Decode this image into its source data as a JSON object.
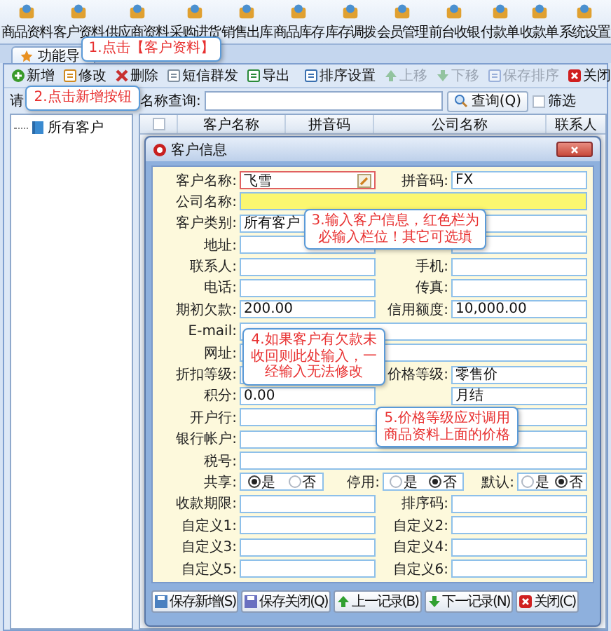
{
  "main_toolbar": [
    "商品资料",
    "客户资料",
    "供应商资料",
    "采购进货",
    "销售出库",
    "商品库存",
    "库存调拨",
    "会员管理",
    "前台收银",
    "付款单",
    "收款单",
    "系统设置"
  ],
  "tab": {
    "label": "功能导"
  },
  "toolbar": [
    {
      "label": "新增",
      "kind": "add",
      "disabled": false
    },
    {
      "label": "修改",
      "kind": "edit",
      "disabled": false
    },
    {
      "label": "删除",
      "kind": "delete",
      "disabled": false
    },
    {
      "label": "短信群发",
      "kind": "sms",
      "disabled": false
    },
    {
      "label": "导出",
      "kind": "export",
      "disabled": false
    },
    {
      "label": "排序设置",
      "kind": "sort",
      "disabled": false
    },
    {
      "label": "上移",
      "kind": "up",
      "disabled": true
    },
    {
      "label": "下移",
      "kind": "down",
      "disabled": true
    },
    {
      "label": "保存排序",
      "kind": "save",
      "disabled": true
    },
    {
      "label": "关闭",
      "kind": "close",
      "disabled": false
    }
  ],
  "search": {
    "prefix": "请",
    "label": "名称查询:",
    "button": "查询(Q)",
    "filter": {
      "label": "筛选",
      "checked": false
    }
  },
  "tree": [
    {
      "label": "所有客户"
    }
  ],
  "table": {
    "select_all": {
      "checked": false
    },
    "columns": [
      "客户名称",
      "拼音码",
      "公司名称",
      "联系人"
    ]
  },
  "dialog": {
    "title": "客户信息",
    "rows": [
      {
        "kind": "pair",
        "fields": [
          {
            "label": "客户名称:",
            "value": "飞雪",
            "kind": "edit",
            "required": true,
            "focused": false
          },
          {
            "label": "拼音码:",
            "value": "FX",
            "kind": "text",
            "required": false,
            "focused": false
          }
        ]
      },
      {
        "kind": "full",
        "fields": [
          {
            "label": "公司名称:",
            "kind": "text",
            "required": false,
            "focused": true
          }
        ]
      },
      {
        "kind": "pair",
        "fields": [
          {
            "label": "客户类别:",
            "value": "所有客户",
            "kind": "dropdown",
            "required": false,
            "focused": false
          },
          {
            "kind": "text",
            "required": false,
            "focused": false
          }
        ]
      },
      {
        "kind": "pair",
        "fields": [
          {
            "label": "地址:",
            "kind": "text",
            "required": false,
            "focused": false
          },
          {
            "kind": "text",
            "required": false,
            "focused": false
          }
        ]
      },
      {
        "kind": "pair",
        "fields": [
          {
            "label": "联系人:",
            "kind": "text",
            "required": false,
            "focused": false
          },
          {
            "label": "手机:",
            "kind": "text",
            "required": false,
            "focused": false
          }
        ]
      },
      {
        "kind": "pair",
        "fields": [
          {
            "label": "电话:",
            "kind": "text",
            "required": false,
            "focused": false
          },
          {
            "label": "传真:",
            "kind": "text",
            "required": false,
            "focused": false
          }
        ]
      },
      {
        "kind": "pair",
        "fields": [
          {
            "label": "期初欠款:",
            "value": "200.00",
            "kind": "text",
            "required": false,
            "focused": false
          },
          {
            "label": "信用额度:",
            "value": "10,000.00",
            "kind": "text",
            "required": false,
            "focused": false
          }
        ]
      },
      {
        "kind": "full",
        "fields": [
          {
            "label": "E-mail:",
            "kind": "text",
            "required": false,
            "focused": false
          }
        ]
      },
      {
        "kind": "full",
        "fields": [
          {
            "label": "网址:",
            "kind": "text",
            "required": false,
            "focused": false
          }
        ]
      },
      {
        "kind": "pair",
        "fields": [
          {
            "label": "折扣等级:",
            "kind": "text",
            "required": false,
            "focused": false
          },
          {
            "label": "价格等级:",
            "value": "零售价",
            "kind": "text",
            "required": false,
            "focused": false
          }
        ]
      },
      {
        "kind": "pair",
        "fields": [
          {
            "label": "积分:",
            "value": "0.00",
            "kind": "text",
            "required": false,
            "focused": false
          },
          {
            "value": "月结",
            "kind": "text",
            "required": false,
            "focused": false
          }
        ]
      },
      {
        "kind": "full",
        "fields": [
          {
            "label": "开户行:",
            "kind": "text",
            "required": false,
            "focused": false
          }
        ]
      },
      {
        "kind": "full",
        "fields": [
          {
            "label": "银行帐户:",
            "kind": "text",
            "required": false,
            "focused": false
          }
        ]
      },
      {
        "kind": "full",
        "fields": [
          {
            "label": "税号:",
            "kind": "text",
            "required": false,
            "focused": false
          }
        ]
      },
      {
        "kind": "radios",
        "groups": [
          {
            "label": "共享:",
            "options": [
              {
                "label": "是",
                "selected": true
              },
              {
                "label": "否",
                "selected": false
              }
            ]
          },
          {
            "label": "停用:",
            "options": [
              {
                "label": "是",
                "selected": false
              },
              {
                "label": "否",
                "selected": true
              }
            ]
          },
          {
            "label": "默认:",
            "options": [
              {
                "label": "是",
                "selected": false
              },
              {
                "label": "否",
                "selected": true
              }
            ]
          }
        ]
      },
      {
        "kind": "pair",
        "fields": [
          {
            "label": "收款期限:",
            "kind": "text",
            "required": false,
            "focused": false
          },
          {
            "label": "排序码:",
            "kind": "text",
            "required": false,
            "focused": false
          }
        ]
      },
      {
        "kind": "pair",
        "fields": [
          {
            "label": "自定义1:",
            "kind": "text",
            "required": false,
            "focused": false
          },
          {
            "label": "自定义2:",
            "kind": "text",
            "required": false,
            "focused": false
          }
        ]
      },
      {
        "kind": "pair",
        "fields": [
          {
            "label": "自定义3:",
            "kind": "text",
            "required": false,
            "focused": false
          },
          {
            "label": "自定义4:",
            "kind": "text",
            "required": false,
            "focused": false
          }
        ]
      },
      {
        "kind": "pair",
        "fields": [
          {
            "label": "自定义5:",
            "kind": "text",
            "required": false,
            "focused": false
          },
          {
            "label": "自定义6:",
            "kind": "text",
            "required": false,
            "focused": false
          }
        ]
      }
    ],
    "buttons": [
      {
        "label": "保存新增(S)",
        "kind": "save_new"
      },
      {
        "label": "保存关闭(Q)",
        "kind": "save"
      },
      {
        "label": "上一记录(B)",
        "kind": "prev"
      },
      {
        "label": "下一记录(N)",
        "kind": "next"
      },
      {
        "label": "关闭(C)",
        "kind": "close"
      }
    ]
  },
  "callouts": [
    {
      "text": "1.点击【客户资料】"
    },
    {
      "text": "2.点击新增按钮"
    },
    {
      "text": "3.输入客户信息，红色栏为必输入栏位！其它可选填"
    },
    {
      "text": "4.如果客户有欠款未收回则此处输入，一经输入无法修改"
    },
    {
      "text": "5.价格等级应对调用商品资料上面的价格"
    }
  ]
}
